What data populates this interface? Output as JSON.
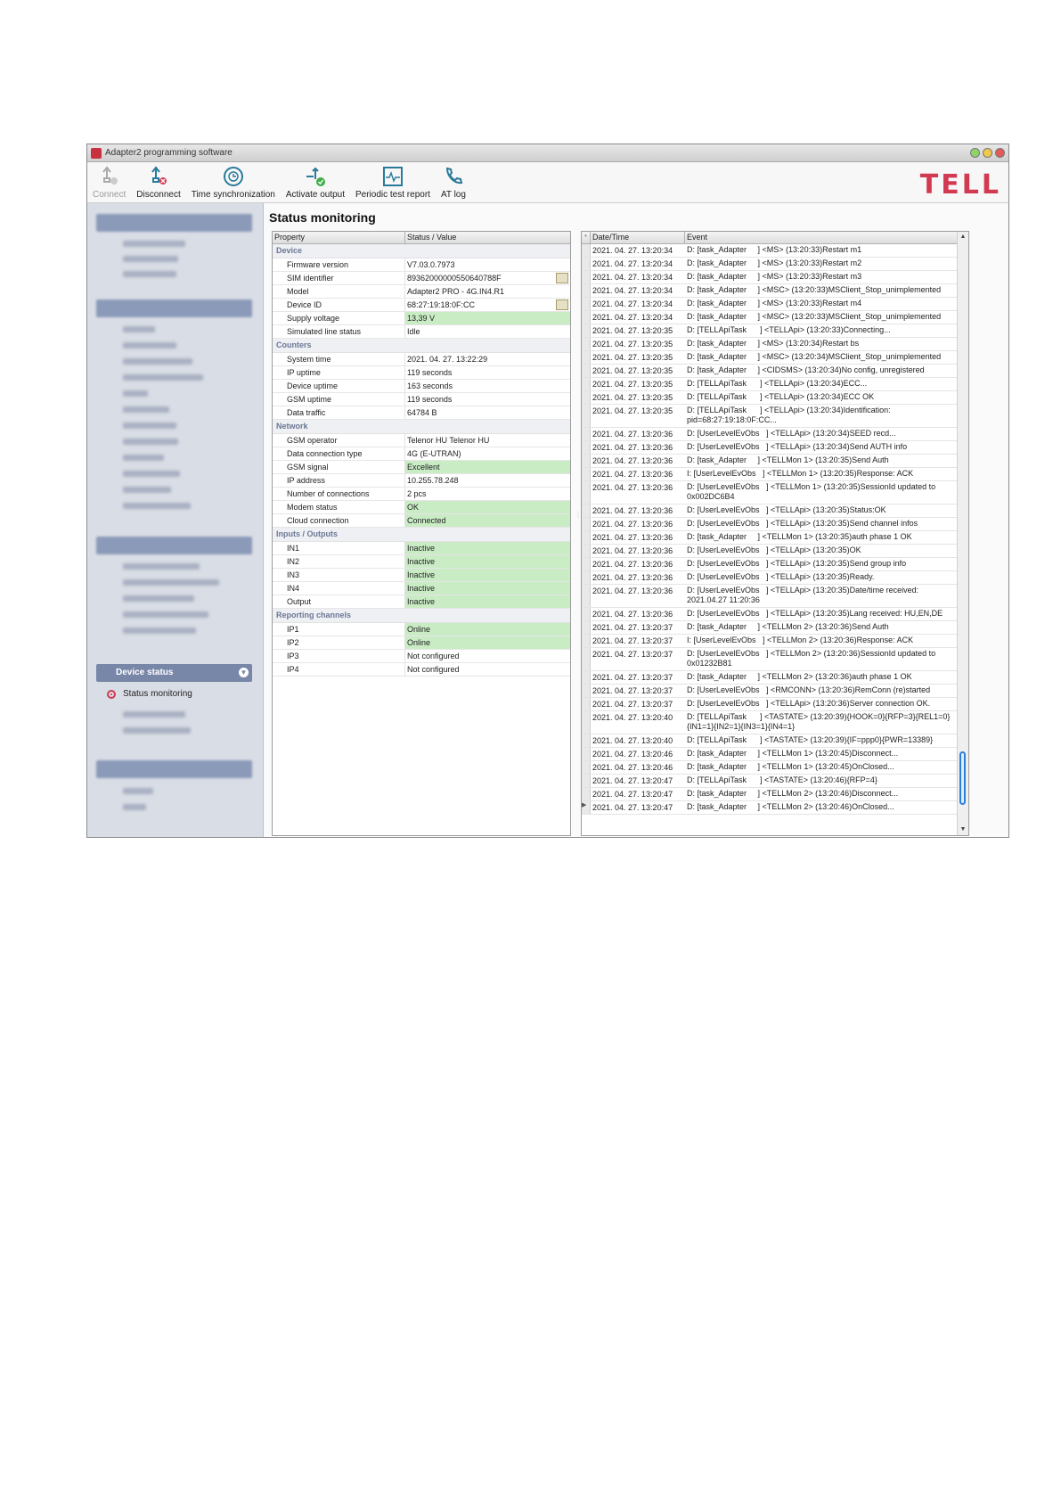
{
  "window": {
    "title": "Adapter2 programming software"
  },
  "toolbar": {
    "connect": "Connect",
    "disconnect": "Disconnect",
    "time_sync": "Time synchronization",
    "activate_output": "Activate output",
    "periodic_test": "Periodic test report",
    "at_log": "AT log",
    "logo": "TELL"
  },
  "sidebar": {
    "device_status": "Device status",
    "status_monitoring": "Status monitoring"
  },
  "main": {
    "title": "Status monitoring",
    "prop_col": "Property",
    "value_col": "Status / Value"
  },
  "properties": {
    "device": "Device",
    "firmware_label": "Firmware version",
    "firmware": "V7.03.0.7973",
    "sim_label": "SIM identifier",
    "sim": "89362000000550640788F",
    "model_label": "Model",
    "model": "Adapter2 PRO - 4G.IN4.R1",
    "devid_label": "Device ID",
    "devid": "68:27:19:18:0F:CC",
    "supply_label": "Supply voltage",
    "supply": "13,39 V",
    "simline_label": "Simulated line status",
    "simline": "Idle",
    "counters": "Counters",
    "systime_label": "System time",
    "systime": "2021. 04. 27. 13:22:29",
    "ipup_label": "IP uptime",
    "ipup": "119 seconds",
    "devup_label": "Device uptime",
    "devup": "163 seconds",
    "gsmup_label": "GSM uptime",
    "gsmup": "119 seconds",
    "traffic_label": "Data traffic",
    "traffic": "64784 B",
    "network": "Network",
    "op_label": "GSM operator",
    "op": "Telenor HU Telenor HU",
    "conntype_label": "Data connection type",
    "conntype": "4G (E-UTRAN)",
    "signal_label": "GSM signal",
    "signal": "Excellent",
    "ip_label": "IP address",
    "ip": "10.255.78.248",
    "nconn_label": "Number of connections",
    "nconn": "2 pcs",
    "modem_label": "Modem status",
    "modem": "OK",
    "cloud_label": "Cloud connection",
    "cloud": "Connected",
    "io": "Inputs / Outputs",
    "in1_label": "IN1",
    "in1": "Inactive",
    "in2_label": "IN2",
    "in2": "Inactive",
    "in3_label": "IN3",
    "in3": "Inactive",
    "in4_label": "IN4",
    "in4": "Inactive",
    "out_label": "Output",
    "out": "Inactive",
    "reporting": "Reporting channels",
    "ip1_label": "IP1",
    "ip1": "Online",
    "ip2_label": "IP2",
    "ip2": "Online",
    "ip3_label": "IP3",
    "ip3": "Not configured",
    "ip4_label": "IP4",
    "ip4": "Not configured"
  },
  "log": {
    "date_col": "Date/Time",
    "event_col": "Event",
    "rows": [
      [
        "2021. 04. 27. 13:20:34",
        "D: [task_Adapter     ] <MS> (13:20:33)Restart m1"
      ],
      [
        "2021. 04. 27. 13:20:34",
        "D: [task_Adapter     ] <MS> (13:20:33)Restart m2"
      ],
      [
        "2021. 04. 27. 13:20:34",
        "D: [task_Adapter     ] <MS> (13:20:33)Restart m3"
      ],
      [
        "2021. 04. 27. 13:20:34",
        "D: [task_Adapter     ] <MSC> (13:20:33)MSClient_Stop_unimplemented"
      ],
      [
        "2021. 04. 27. 13:20:34",
        "D: [task_Adapter     ] <MS> (13:20:33)Restart m4"
      ],
      [
        "2021. 04. 27. 13:20:34",
        "D: [task_Adapter     ] <MSC> (13:20:33)MSClient_Stop_unimplemented"
      ],
      [
        "2021. 04. 27. 13:20:35",
        "D: [TELLApiTask      ] <TELLApi> (13:20:33)Connecting..."
      ],
      [
        "2021. 04. 27. 13:20:35",
        "D: [task_Adapter     ] <MS> (13:20:34)Restart bs"
      ],
      [
        "2021. 04. 27. 13:20:35",
        "D: [task_Adapter     ] <MSC> (13:20:34)MSClient_Stop_unimplemented"
      ],
      [
        "2021. 04. 27. 13:20:35",
        "D: [task_Adapter     ] <CIDSMS> (13:20:34)No config, unregistered"
      ],
      [
        "2021. 04. 27. 13:20:35",
        "D: [TELLApiTask      ] <TELLApi> (13:20:34)ECC..."
      ],
      [
        "2021. 04. 27. 13:20:35",
        "D: [TELLApiTask      ] <TELLApi> (13:20:34)ECC OK"
      ],
      [
        "2021. 04. 27. 13:20:35",
        "D: [TELLApiTask      ] <TELLApi> (13:20:34)Identification: pid=68:27:19:18:0F:CC..."
      ],
      [
        "2021. 04. 27. 13:20:36",
        "D: [UserLevelEvObs   ] <TELLApi> (13:20:34)SEED recd..."
      ],
      [
        "2021. 04. 27. 13:20:36",
        "D: [UserLevelEvObs   ] <TELLApi> (13:20:34)Send AUTH info"
      ],
      [
        "2021. 04. 27. 13:20:36",
        "D: [task_Adapter     ] <TELLMon 1> (13:20:35)Send Auth"
      ],
      [
        "2021. 04. 27. 13:20:36",
        "I: [UserLevelEvObs   ] <TELLMon 1> (13:20:35)Response: ACK"
      ],
      [
        "2021. 04. 27. 13:20:36",
        "D: [UserLevelEvObs   ] <TELLMon 1> (13:20:35)SessionId updated to 0x002DC6B4"
      ],
      [
        "2021. 04. 27. 13:20:36",
        "D: [UserLevelEvObs   ] <TELLApi> (13:20:35)Status:OK"
      ],
      [
        "2021. 04. 27. 13:20:36",
        "D: [UserLevelEvObs   ] <TELLApi> (13:20:35)Send channel infos"
      ],
      [
        "2021. 04. 27. 13:20:36",
        "D: [task_Adapter     ] <TELLMon 1> (13:20:35)auth phase 1 OK"
      ],
      [
        "2021. 04. 27. 13:20:36",
        "D: [UserLevelEvObs   ] <TELLApi> (13:20:35)OK"
      ],
      [
        "2021. 04. 27. 13:20:36",
        "D: [UserLevelEvObs   ] <TELLApi> (13:20:35)Send group info"
      ],
      [
        "2021. 04. 27. 13:20:36",
        "D: [UserLevelEvObs   ] <TELLApi> (13:20:35)Ready."
      ],
      [
        "2021. 04. 27. 13:20:36",
        "D: [UserLevelEvObs   ] <TELLApi> (13:20:35)Date/time received: 2021.04.27 11:20:36"
      ],
      [
        "2021. 04. 27. 13:20:36",
        "D: [UserLevelEvObs   ] <TELLApi> (13:20:35)Lang received: HU,EN,DE"
      ],
      [
        "2021. 04. 27. 13:20:37",
        "D: [task_Adapter     ] <TELLMon 2> (13:20:36)Send Auth"
      ],
      [
        "2021. 04. 27. 13:20:37",
        "I: [UserLevelEvObs   ] <TELLMon 2> (13:20:36)Response: ACK"
      ],
      [
        "2021. 04. 27. 13:20:37",
        "D: [UserLevelEvObs   ] <TELLMon 2> (13:20:36)SessionId updated to 0x01232B81"
      ],
      [
        "2021. 04. 27. 13:20:37",
        "D: [task_Adapter     ] <TELLMon 2> (13:20:36)auth phase 1 OK"
      ],
      [
        "2021. 04. 27. 13:20:37",
        "D: [UserLevelEvObs   ] <RMCONN> (13:20:36)RemConn (re)started"
      ],
      [
        "2021. 04. 27. 13:20:37",
        "D: [UserLevelEvObs   ] <TELLApi> (13:20:36)Server connection OK."
      ],
      [
        "2021. 04. 27. 13:20:40",
        "D: [TELLApiTask      ] <TASTATE> (13:20:39){HOOK=0}{RFP=3}{REL1=0}{IN1=1}{IN2=1}{IN3=1}{IN4=1}"
      ],
      [
        "2021. 04. 27. 13:20:40",
        "D: [TELLApiTask      ] <TASTATE> (13:20:39){IF=ppp0}{PWR=13389}"
      ],
      [
        "2021. 04. 27. 13:20:46",
        "D: [task_Adapter     ] <TELLMon 1> (13:20:45)Disconnect..."
      ],
      [
        "2021. 04. 27. 13:20:46",
        "D: [task_Adapter     ] <TELLMon 1> (13:20:45)OnClosed..."
      ],
      [
        "2021. 04. 27. 13:20:47",
        "D: [TELLApiTask      ] <TASTATE> (13:20:46){RFP=4}"
      ],
      [
        "2021. 04. 27. 13:20:47",
        "D: [task_Adapter     ] <TELLMon 2> (13:20:46)Disconnect..."
      ],
      [
        "2021. 04. 27. 13:20:47",
        "D: [task_Adapter     ] <TELLMon 2> (13:20:46)OnClosed..."
      ]
    ]
  },
  "colors": {
    "accent": "#d23a51",
    "ok_bg": "#c9ecc5",
    "nav": "#7886a8"
  }
}
